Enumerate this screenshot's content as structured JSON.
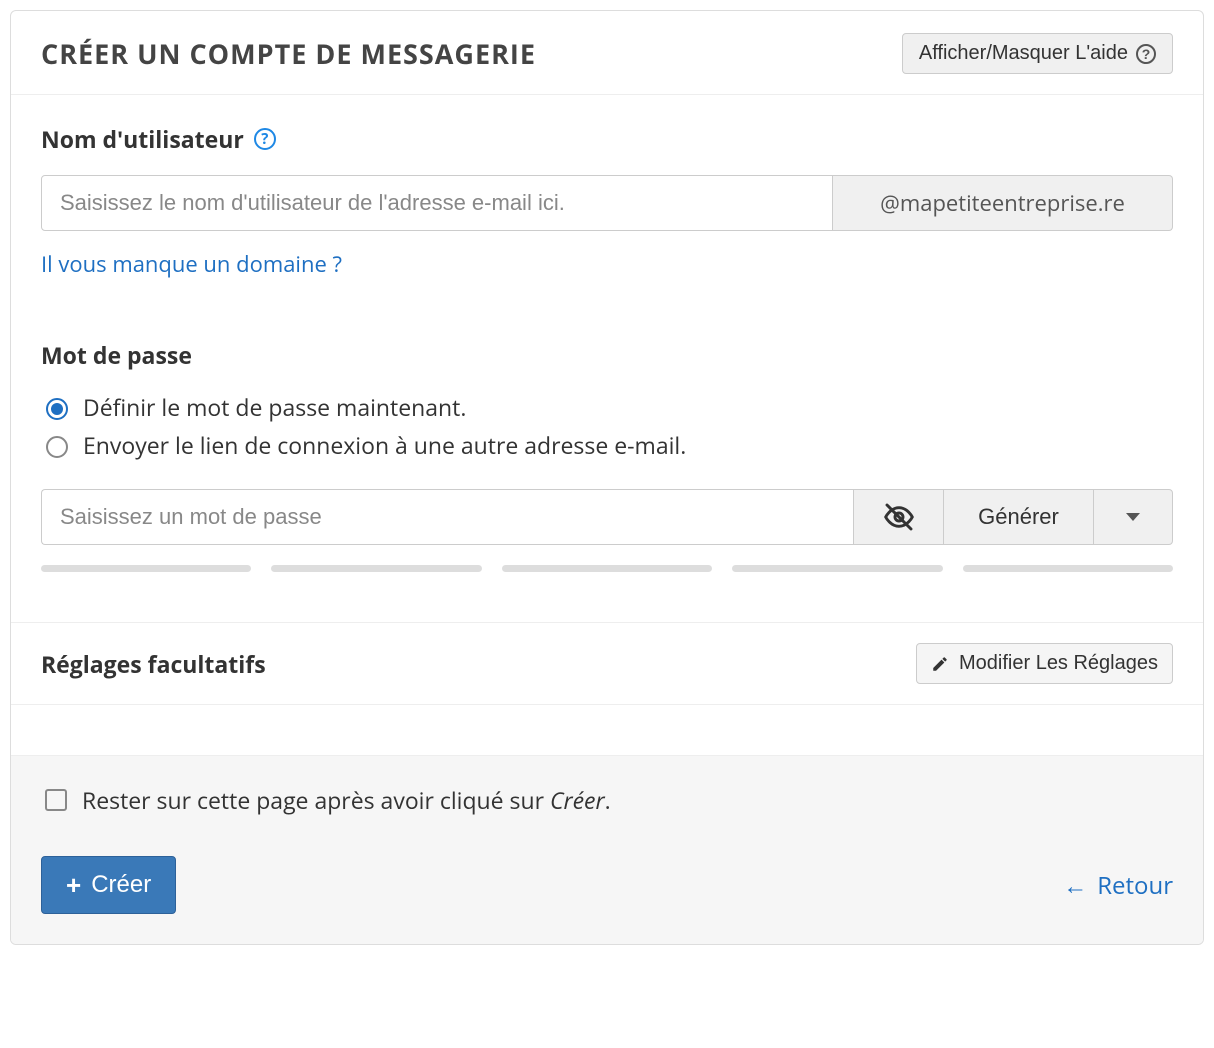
{
  "header": {
    "title": "Créer un compte de messagerie",
    "help_toggle_label": "Afficher/Masquer L'aide"
  },
  "username": {
    "label": "Nom d'utilisateur",
    "placeholder": "Saisissez le nom d'utilisateur de l'adresse e-mail ici.",
    "domain": "@mapetiteentreprise.re",
    "missing_domain_link": "Il vous manque un domaine ?"
  },
  "password": {
    "label": "Mot de passe",
    "options": {
      "set_now": "Définir le mot de passe maintenant.",
      "send_link": "Envoyer le lien de connexion à une autre adresse e-mail."
    },
    "selected_option": "set_now",
    "placeholder": "Saisissez un mot de passe",
    "generate_label": "Générer"
  },
  "optional": {
    "title": "Réglages facultatifs",
    "edit_label": "Modifier Les Réglages"
  },
  "footer": {
    "stay_label_prefix": "Rester sur cette page après avoir cliqué sur ",
    "stay_label_em": "Créer",
    "stay_label_suffix": ".",
    "create_label": "Créer",
    "back_label": "Retour"
  }
}
